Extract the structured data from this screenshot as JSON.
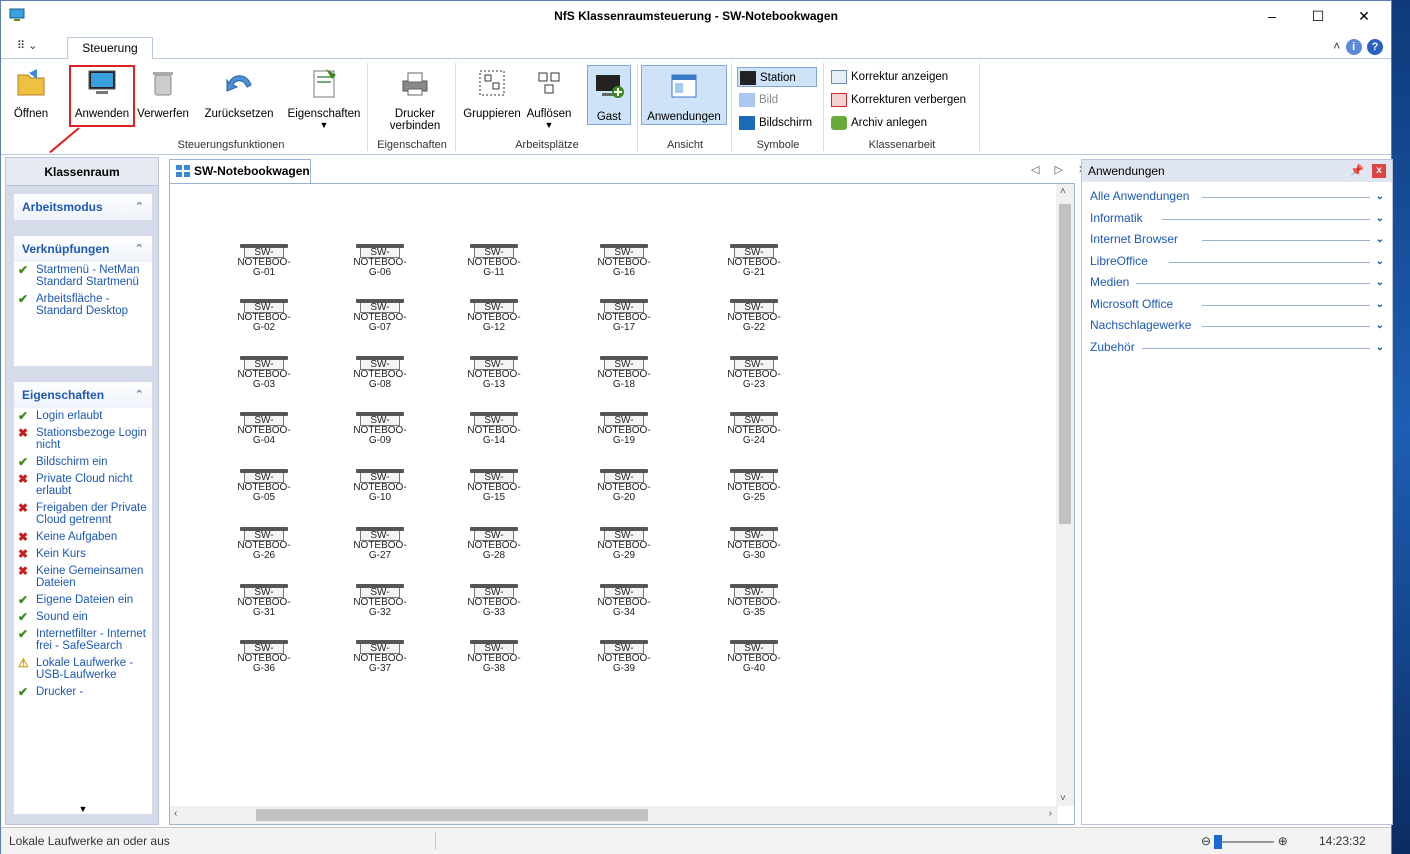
{
  "window": {
    "title": "NfS Klassenraumsteuerung - SW-Notebookwagen",
    "min": "–",
    "max": "☐",
    "close": "✕"
  },
  "tabs": {
    "qat": "⠿ ⌄",
    "active": "Steuerung",
    "right": "˄",
    "help": "?"
  },
  "ribbon": {
    "oeffnen": "Öffnen",
    "anwenden": "Anwenden",
    "verwerfen": "Verwerfen",
    "zuruecksetzen": "Zurücksetzen",
    "eigenschaften": "Eigenschaften",
    "drucker_verbinden": "Drucker verbinden",
    "gruppieren": "Gruppieren",
    "aufloesen": "Auflösen",
    "gast": "Gast",
    "anwendungen": "Anwendungen",
    "station": "Station",
    "bild": "Bild",
    "bildschirm": "Bildschirm",
    "korrektur_anzeigen": "Korrektur anzeigen",
    "korrekturen_verbergen": "Korrekturen verbergen",
    "archiv_anlegen": "Archiv anlegen",
    "groups": {
      "steuerungsfunktionen": "Steuerungsfunktionen",
      "eigenschaften": "Eigenschaften",
      "arbeitsplaetze": "Arbeitsplätze",
      "ansicht": "Ansicht",
      "symbole": "Symbole",
      "klassenarbeit": "Klassenarbeit"
    }
  },
  "left": {
    "header": "Klassenraum",
    "arbeitsmodus": "Arbeitsmodus",
    "verknuepfungen": "Verknüpfungen",
    "links": [
      {
        "mark": "ok",
        "text": "Startmenü - NetMan Standard Startmenü"
      },
      {
        "mark": "ok",
        "text": "Arbeitsfläche - Standard Desktop"
      }
    ],
    "eigenschaften": "Eigenschaften",
    "props": [
      {
        "mark": "ok",
        "text": "Login erlaubt"
      },
      {
        "mark": "no",
        "text": "Stationsbezoge Login nicht"
      },
      {
        "mark": "ok",
        "text": "Bildschirm ein"
      },
      {
        "mark": "no",
        "text": "Private Cloud nicht erlaubt"
      },
      {
        "mark": "no",
        "text": "Freigaben der Private Cloud getrennt"
      },
      {
        "mark": "no",
        "text": "Keine Aufgaben"
      },
      {
        "mark": "no",
        "text": "Kein Kurs"
      },
      {
        "mark": "no",
        "text": "Keine Gemeinsamen Dateien"
      },
      {
        "mark": "ok",
        "text": "Eigene Dateien ein"
      },
      {
        "mark": "ok",
        "text": "Sound ein"
      },
      {
        "mark": "ok",
        "text": "Internetfilter - Internet frei - SafeSearch"
      },
      {
        "mark": "warn",
        "text": "Lokale Laufwerke - USB-Laufwerke"
      },
      {
        "mark": "ok",
        "text": "Drucker -"
      }
    ]
  },
  "doc": {
    "tab": "SW-Notebookwagen",
    "nav": "◁ ▷ ✕",
    "notebooks": [
      [
        "G-01",
        "G-06",
        "G-11",
        "G-16",
        "G-21"
      ],
      [
        "G-02",
        "G-07",
        "G-12",
        "G-17",
        "G-22"
      ],
      [
        "G-03",
        "G-08",
        "G-13",
        "G-18",
        "G-23"
      ],
      [
        "G-04",
        "G-09",
        "G-14",
        "G-19",
        "G-24"
      ],
      [
        "G-05",
        "G-10",
        "G-15",
        "G-20",
        "G-25"
      ],
      [
        "G-26",
        "G-27",
        "G-28",
        "G-29",
        "G-30"
      ],
      [
        "G-31",
        "G-32",
        "G-33",
        "G-34",
        "G-35"
      ],
      [
        "G-36",
        "G-37",
        "G-38",
        "G-39",
        "G-40"
      ]
    ],
    "label_prefix": "SW-",
    "label_mid": "NOTEBOO-"
  },
  "right": {
    "header": "Anwendungen",
    "categories": [
      "Alle Anwendungen",
      "Informatik",
      "Internet Browser",
      "LibreOffice",
      "Medien",
      "Microsoft Office",
      "Nachschlagewerke",
      "Zubehör"
    ]
  },
  "status": {
    "text": "Lokale Laufwerke an oder aus",
    "time": "14:23:32"
  }
}
